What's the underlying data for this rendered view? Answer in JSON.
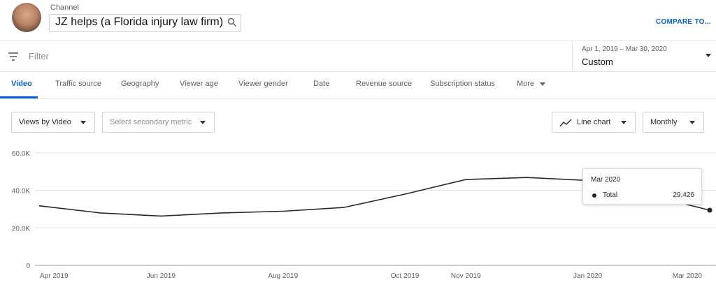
{
  "header": {
    "channel_label": "Channel",
    "channel_name": "JZ helps (a Florida injury law firm)",
    "compare_button": "COMPARE TO..."
  },
  "filter": {
    "placeholder": "Filter",
    "date_range": "Apr 1, 2019 – Mar 30, 2020",
    "date_preset": "Custom"
  },
  "tabs": [
    {
      "label": "Video",
      "active": true
    },
    {
      "label": "Traffic source"
    },
    {
      "label": "Geography"
    },
    {
      "label": "Viewer age"
    },
    {
      "label": "Viewer gender"
    },
    {
      "label": "Date"
    },
    {
      "label": "Revenue source"
    },
    {
      "label": "Subscription status"
    },
    {
      "label": "More"
    }
  ],
  "controls": {
    "primary_metric": "Views by Video",
    "secondary_metric_placeholder": "Select secondary metric",
    "chart_type": "Line chart",
    "interval": "Monthly"
  },
  "tooltip": {
    "title": "Mar 2020",
    "series": "Total",
    "value": "29,426"
  },
  "colors": {
    "accent": "#065fd4",
    "line": "#282828",
    "grid": "#e0e0e0"
  },
  "chart_data": {
    "type": "line",
    "x": [
      "Apr 2019",
      "May 2019",
      "Jun 2019",
      "Jul 2019",
      "Aug 2019",
      "Sep 2019",
      "Oct 2019",
      "Nov 2019",
      "Dec 2019",
      "Jan 2020",
      "Feb 2020",
      "Mar 2020"
    ],
    "series": [
      {
        "name": "Total",
        "values": [
          31800,
          28000,
          26300,
          28000,
          28900,
          30900,
          38000,
          45800,
          46900,
          45300,
          37500,
          29426
        ]
      }
    ],
    "ylim": [
      0,
      60000
    ],
    "y_ticks": [
      "0",
      "20.0K",
      "40.0K",
      "60.0K"
    ],
    "x_tick_labels": [
      "Apr 2019",
      "Jun 2019",
      "Aug 2019",
      "Oct 2019",
      "Nov 2019",
      "Jan 2020",
      "Mar 2020"
    ],
    "x_tick_indices": [
      0,
      2,
      4,
      6,
      7,
      9,
      11
    ],
    "grid": true
  }
}
